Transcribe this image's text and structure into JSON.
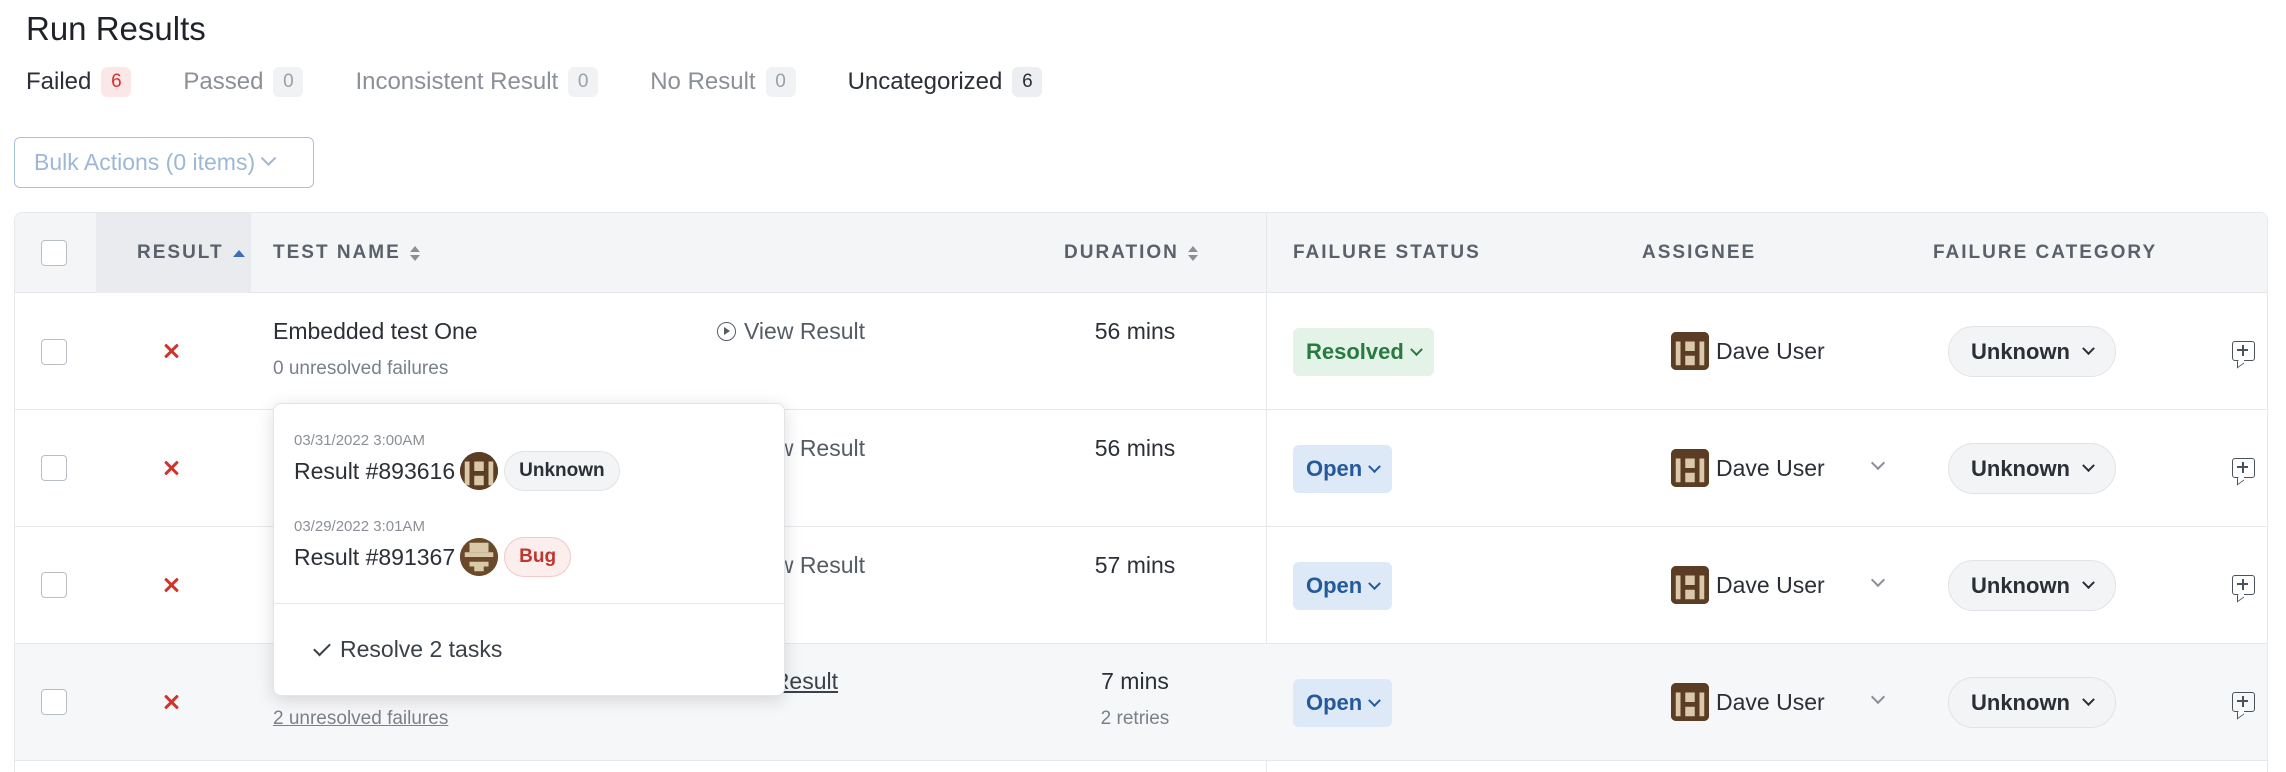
{
  "page": {
    "title": "Run Results"
  },
  "tabs": [
    {
      "label": "Failed",
      "count": "6"
    },
    {
      "label": "Passed",
      "count": "0"
    },
    {
      "label": "Inconsistent Result",
      "count": "0"
    },
    {
      "label": "No Result",
      "count": "0"
    },
    {
      "label": "Uncategorized",
      "count": "6"
    }
  ],
  "toolbar": {
    "bulk_actions_label": "Bulk Actions (0 items)"
  },
  "table": {
    "columns": {
      "result": "RESULT",
      "test_name": "TEST NAME",
      "duration": "DURATION",
      "failure_status": "FAILURE STATUS",
      "assignee": "ASSIGNEE",
      "failure_category": "FAILURE CATEGORY"
    },
    "view_result_label": "View Result",
    "rows": [
      {
        "test_name": "Embedded test One",
        "sub": "0 unresolved failures",
        "duration": "56 mins",
        "retries": "",
        "status": "Resolved",
        "assignee": "Dave User",
        "category": "Unknown"
      },
      {
        "test_name": "",
        "sub": "",
        "duration": "56 mins",
        "retries": "",
        "status": "Open",
        "assignee": "Dave User",
        "category": "Unknown"
      },
      {
        "test_name": "",
        "sub": "",
        "duration": "57 mins",
        "retries": "",
        "status": "Open",
        "assignee": "Dave User",
        "category": "Unknown"
      },
      {
        "test_name": "",
        "sub": "2 unresolved failures",
        "duration": "7 mins",
        "retries": "2 retries",
        "status": "Open",
        "assignee": "Dave User",
        "category": "Unknown"
      }
    ]
  },
  "popover": {
    "items": [
      {
        "date": "03/31/2022 3:00AM",
        "result": "Result #893616",
        "category": "Unknown"
      },
      {
        "date": "03/29/2022 3:01AM",
        "result": "Result #891367",
        "category": "Bug"
      }
    ],
    "action_label": "Resolve 2 tasks"
  },
  "colors": {
    "failed": "#d0342c",
    "resolved": "#287a3e",
    "open": "#245a9c",
    "accent": "#3b6fb6"
  },
  "icons": {
    "result_failed": "x-icon",
    "view_result": "play-circle-icon",
    "comment": "comment-add-icon",
    "resolve": "check-icon"
  }
}
